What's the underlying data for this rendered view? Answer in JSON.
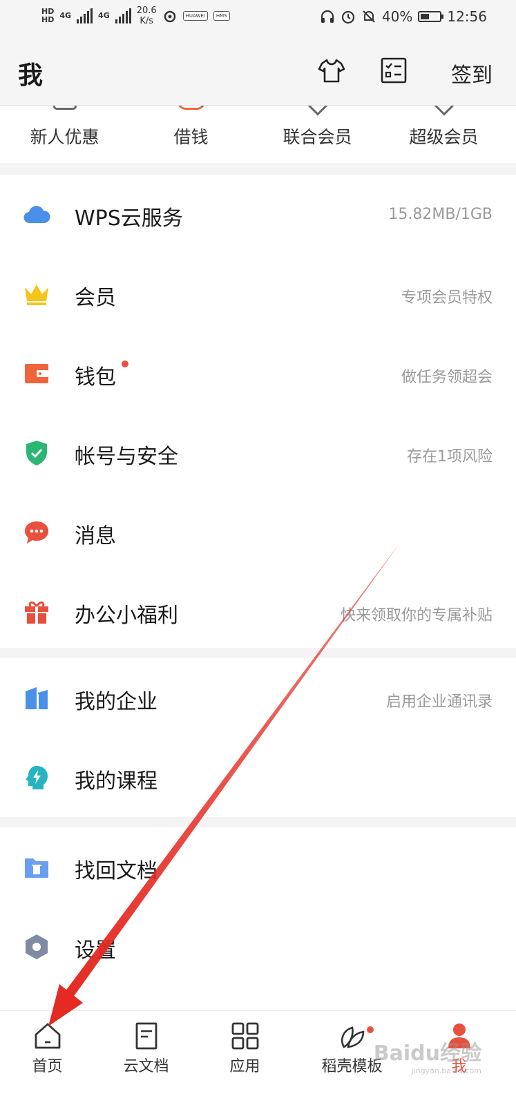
{
  "status_bar": {
    "hd1": "HD",
    "hd2": "HD",
    "net1": "4G",
    "net2": "4G",
    "speed_value": "20.6",
    "speed_unit": "K/s",
    "battery": "40%",
    "time": "12:56",
    "pill1": "HUAWEI",
    "pill2": "HMS"
  },
  "header": {
    "title": "我",
    "sign_in": "签到"
  },
  "quick_actions": [
    {
      "label": "新人优惠"
    },
    {
      "label": "借钱"
    },
    {
      "label": "联合会员"
    },
    {
      "label": "超级会员"
    }
  ],
  "groups": {
    "main": [
      {
        "label": "WPS云服务",
        "sub": "15.82MB/1GB",
        "icon": "cloud-icon",
        "color": "#4a90e8"
      },
      {
        "label": "会员",
        "sub": "专项会员特权",
        "icon": "crown-icon",
        "color": "#f5c518"
      },
      {
        "label": "钱包",
        "sub": "做任务领超会",
        "icon": "wallet-icon",
        "color": "#f0643c",
        "badge": true
      },
      {
        "label": "帐号与安全",
        "sub": "存在1项风险",
        "icon": "shield-icon",
        "color": "#2bb673"
      },
      {
        "label": "消息",
        "sub": "",
        "icon": "chat-bubble-icon",
        "color": "#e8503e"
      },
      {
        "label": "办公小福利",
        "sub": "快来领取你的专属补贴",
        "icon": "gift-icon",
        "color": "#e8503e"
      }
    ],
    "enterprise": [
      {
        "label": "我的企业",
        "sub": "启用企业通讯录",
        "icon": "building-icon",
        "color": "#4a90e8"
      },
      {
        "label": "我的课程",
        "sub": "",
        "icon": "course-icon",
        "color": "#26b5c0"
      }
    ],
    "tools": [
      {
        "label": "找回文档",
        "sub": "",
        "icon": "folder-trash-icon",
        "color": "#6a9ef0"
      },
      {
        "label": "设置",
        "sub": "",
        "icon": "settings-hexagon-icon",
        "color": "#7f8aa3"
      }
    ]
  },
  "tabs": [
    {
      "label": "首页",
      "icon": "home-icon"
    },
    {
      "label": "云文档",
      "icon": "document-icon"
    },
    {
      "label": "应用",
      "icon": "apps-grid-icon"
    },
    {
      "label": "稻壳模板",
      "icon": "leaf-icon",
      "badge": true
    },
    {
      "label": "我",
      "icon": "person-icon",
      "active": true
    }
  ],
  "watermark": {
    "brand": "Baidu经验",
    "site": "jingyan.baidu.com"
  },
  "colors": {
    "accent": "#e8503e",
    "annotation_arrow": "#e42a22"
  }
}
